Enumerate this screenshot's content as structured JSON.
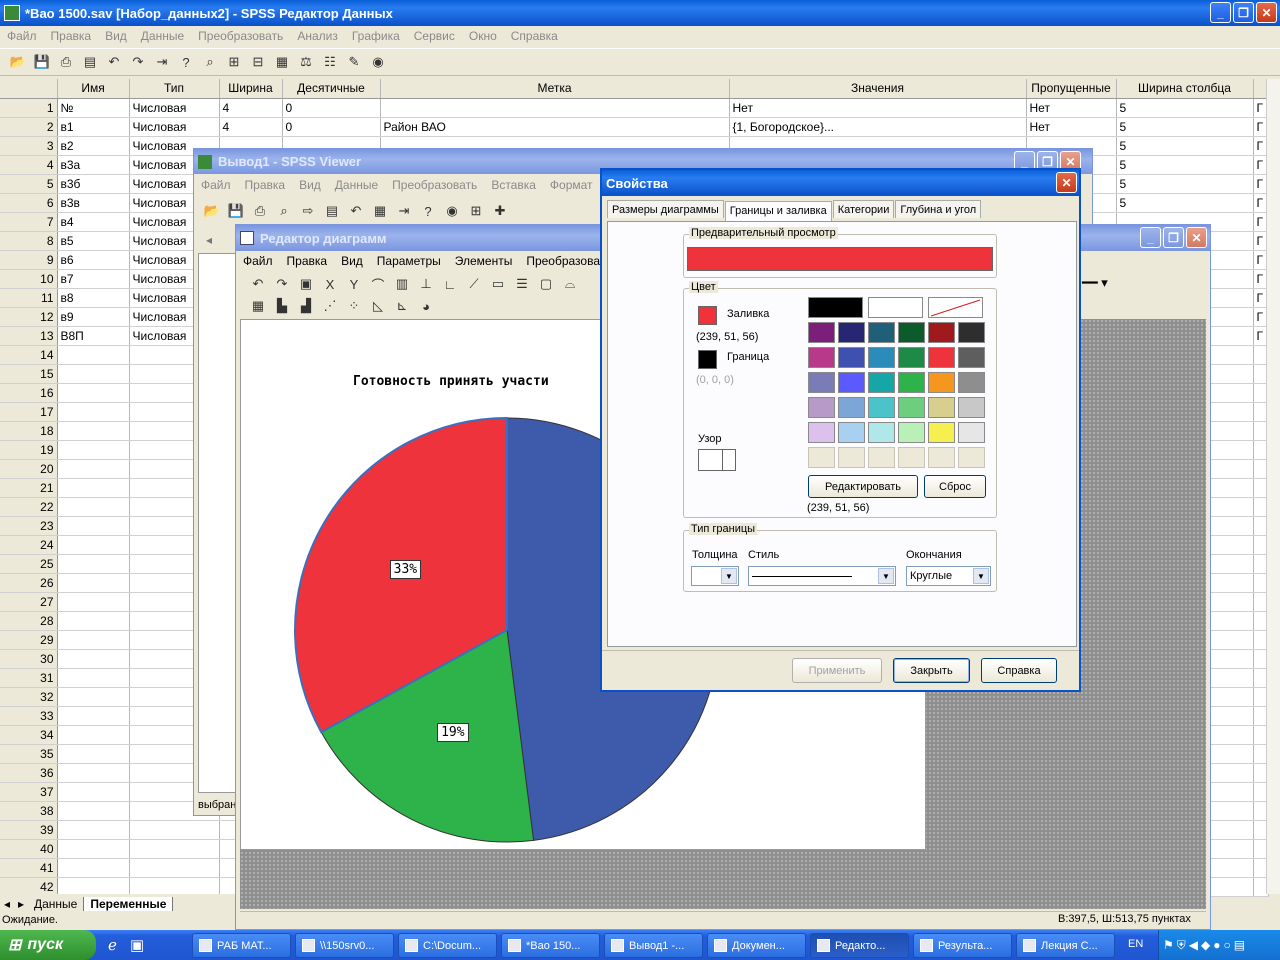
{
  "data_editor": {
    "title": "*Вао 1500.sav [Набор_данных2] - SPSS Редактор Данных",
    "menu": [
      "Файл",
      "Правка",
      "Вид",
      "Данные",
      "Преобразовать",
      "Анализ",
      "Графика",
      "Сервис",
      "Окно",
      "Справка"
    ],
    "columns": [
      "",
      "Имя",
      "Тип",
      "Ширина",
      "Десятичные",
      "Метка",
      "Значения",
      "Пропущенные",
      "Ширина столбца"
    ],
    "rows": [
      {
        "n": "1",
        "name": "№",
        "type": "Числовая",
        "width": "4",
        "dec": "0",
        "label": "",
        "values": "Нет",
        "missing": "Нет",
        "colw": "5"
      },
      {
        "n": "2",
        "name": "в1",
        "type": "Числовая",
        "width": "4",
        "dec": "0",
        "label": "Район ВАО",
        "values": "{1, Богородское}...",
        "missing": "Нет",
        "colw": "5"
      },
      {
        "n": "3",
        "name": "в2",
        "type": "Числовая",
        "width": "",
        "dec": "",
        "label": "",
        "values": "",
        "missing": "",
        "colw": "5"
      },
      {
        "n": "4",
        "name": "в3а",
        "type": "Числовая",
        "width": "",
        "dec": "",
        "label": "",
        "values": "",
        "missing": "",
        "colw": "5"
      },
      {
        "n": "5",
        "name": "в3б",
        "type": "Числовая",
        "width": "",
        "dec": "",
        "label": "",
        "values": "",
        "missing": "",
        "colw": "5"
      },
      {
        "n": "6",
        "name": "в3в",
        "type": "Числовая",
        "width": "",
        "dec": "",
        "label": "",
        "values": "",
        "missing": "",
        "colw": "5"
      },
      {
        "n": "7",
        "name": "в4",
        "type": "Числовая",
        "width": "",
        "dec": "",
        "label": "",
        "values": "",
        "missing": "",
        "colw": ""
      },
      {
        "n": "8",
        "name": "в5",
        "type": "Числовая",
        "width": "",
        "dec": "",
        "label": "",
        "values": "",
        "missing": "",
        "colw": ""
      },
      {
        "n": "9",
        "name": "в6",
        "type": "Числовая",
        "width": "",
        "dec": "",
        "label": "",
        "values": "",
        "missing": "",
        "colw": ""
      },
      {
        "n": "10",
        "name": "в7",
        "type": "Числовая",
        "width": "",
        "dec": "",
        "label": "",
        "values": "",
        "missing": "",
        "colw": ""
      },
      {
        "n": "11",
        "name": "в8",
        "type": "Числовая",
        "width": "",
        "dec": "",
        "label": "",
        "values": "",
        "missing": "",
        "colw": ""
      },
      {
        "n": "12",
        "name": "в9",
        "type": "Числовая",
        "width": "",
        "dec": "",
        "label": "",
        "values": "",
        "missing": "",
        "colw": ""
      },
      {
        "n": "13",
        "name": "В8П",
        "type": "Числовая",
        "width": "",
        "dec": "",
        "label": "",
        "values": "",
        "missing": "",
        "colw": ""
      }
    ],
    "empty_row_numbers": [
      "14",
      "15",
      "16",
      "17",
      "18",
      "19",
      "20",
      "21",
      "22",
      "23",
      "24",
      "25",
      "26",
      "27",
      "28",
      "29",
      "30",
      "31",
      "32",
      "33",
      "34",
      "35",
      "36",
      "37",
      "38",
      "39",
      "40",
      "41",
      "42"
    ],
    "sheet_tabs": [
      "Данные",
      "Переменные"
    ],
    "status": "Ожидание."
  },
  "viewer": {
    "title": "Вывод1 - SPSS Viewer",
    "menu": [
      "Файл",
      "Правка",
      "Вид",
      "Данные",
      "Преобразовать",
      "Вставка",
      "Формат",
      "Анализ"
    ],
    "status_fragment": "выбран"
  },
  "chart_editor": {
    "title": "Редактор диаграмм",
    "menu": [
      "Файл",
      "Правка",
      "Вид",
      "Параметры",
      "Элементы",
      "Преобразовать",
      "Сп"
    ],
    "status": "В:397,5, Ш:513,75 пунктах"
  },
  "chart_data": {
    "type": "pie",
    "title": "Готовность принять участи",
    "slices": [
      {
        "label": "48%",
        "value": 48,
        "color": "#3e5bab"
      },
      {
        "label": "19%",
        "value": 19,
        "color": "#2db34a"
      },
      {
        "label": "33%",
        "value": 33,
        "color": "#ef333c"
      }
    ]
  },
  "properties": {
    "title": "Свойства",
    "tabs": [
      "Размеры диаграммы",
      "Границы и заливка",
      "Категории",
      "Глубина и угол"
    ],
    "preview_label": "Предварительный просмотр",
    "preview_color": "#ef333c",
    "color_label": "Цвет",
    "fill_label": "Заливка",
    "fill_rgb": "(239, 51, 56)",
    "border_label": "Граница",
    "border_rgb": "(0, 0, 0)",
    "pattern_label": "Узор",
    "edit_button": "Редактировать",
    "reset_button": "Сброс",
    "selected_rgb": "(239, 51, 56)",
    "palette": [
      [
        "#000000",
        "#ffffff",
        "none"
      ],
      [
        "#7b1f7b",
        "#262673",
        "#1f5f7a",
        "#0d5a2b",
        "#a0191c",
        "#2e2e2e"
      ],
      [
        "#b8398a",
        "#3f51b0",
        "#2b8cba",
        "#1d8a48",
        "#ef333c",
        "#5e5e5e"
      ],
      [
        "#7a7cb8",
        "#5a5aff",
        "#17a6a8",
        "#2db34a",
        "#f5961f",
        "#8e8e8e"
      ],
      [
        "#b89ac8",
        "#7ca6d8",
        "#4cc3c8",
        "#6cce7e",
        "#d8cf8e",
        "#c8c8c8"
      ],
      [
        "#dcc0ee",
        "#a8d0f0",
        "#b0e8ea",
        "#b8f0b8",
        "#f5f050",
        "#e6e6e6"
      ],
      [
        "#ece9d8",
        "#ece9d8",
        "#ece9d8",
        "#ece9d8",
        "#ece9d8",
        "#ece9d8"
      ]
    ],
    "border_type_label": "Тип границы",
    "weight_label": "Толщина",
    "style_label": "Стиль",
    "caps_label": "Окончания",
    "caps_value": "Круглые",
    "apply_button": "Применить",
    "close_button": "Закрыть",
    "help_button": "Справка"
  },
  "taskbar": {
    "start": "пуск",
    "items": [
      "РАБ МАТ...",
      "\\\\150srv0...",
      "C:\\Docum...",
      "*Вао 150...",
      "Вывод1 -...",
      "Докумен...",
      "Редакто...",
      "Результа...",
      "Лекция С..."
    ],
    "lang": "EN"
  }
}
